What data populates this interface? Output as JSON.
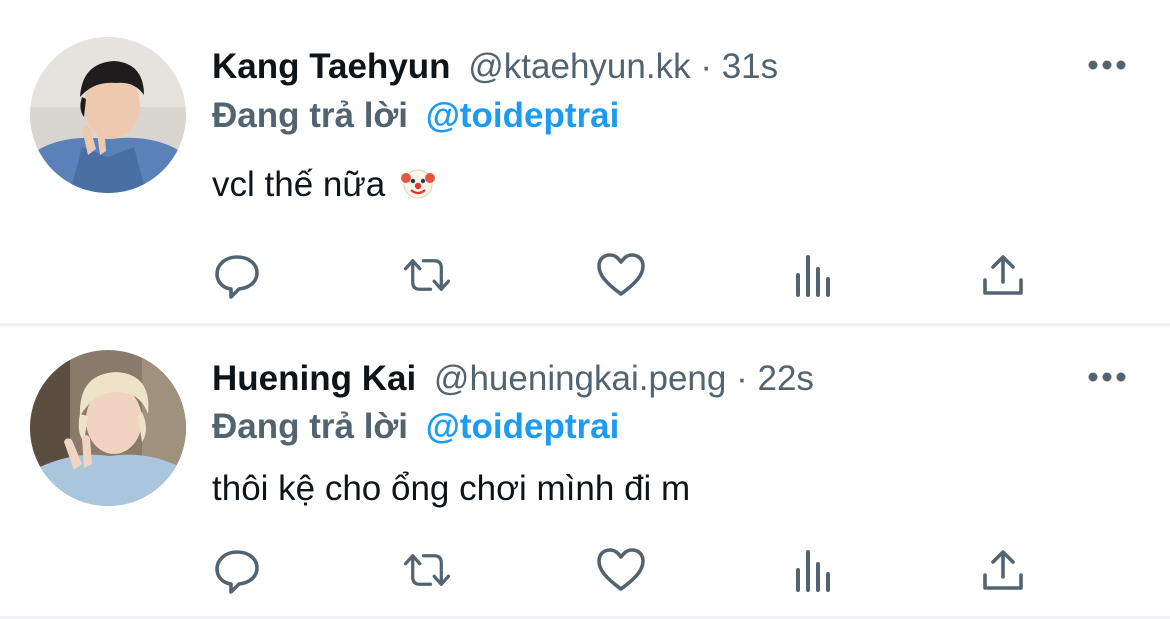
{
  "tweets": [
    {
      "display_name": "Kang Taehyun",
      "handle": "@ktaehyun.kk",
      "separator": "·",
      "time": "31s",
      "reply_prefix": "Đang trả lời",
      "reply_mention": "@toideptrai",
      "text": "vcl thế nữa",
      "emoji_icon": "clown-face-icon",
      "avatar_icon": "avatar-photo-dark-hair",
      "actions": [
        "reply-icon",
        "retweet-icon",
        "like-icon",
        "stats-icon",
        "share-icon"
      ]
    },
    {
      "display_name": "Huening Kai",
      "handle": "@hueningkai.peng",
      "separator": "·",
      "time": "22s",
      "reply_prefix": "Đang trả lời",
      "reply_mention": "@toideptrai",
      "text": "thôi kệ cho ổng chơi mình đi m",
      "avatar_icon": "avatar-photo-blond-hair",
      "actions": [
        "reply-icon",
        "retweet-icon",
        "like-icon",
        "stats-icon",
        "share-icon"
      ]
    }
  ],
  "colors": {
    "text_primary": "#0f1419",
    "text_secondary": "#536471",
    "accent": "#1d9bf0",
    "divider": "#eff3f4"
  }
}
